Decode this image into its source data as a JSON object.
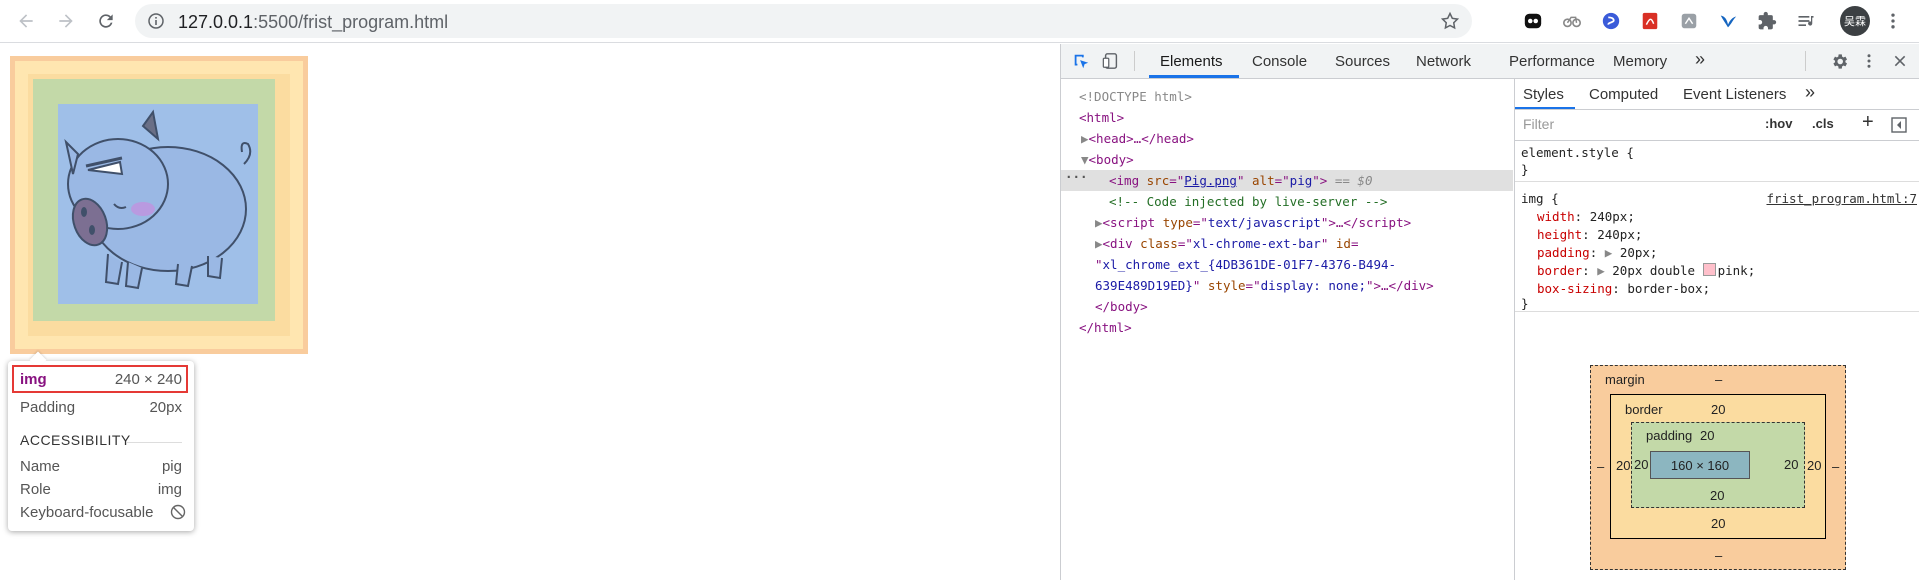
{
  "browser": {
    "url_host": "127.0.0.1",
    "url_rest": ":5500/frist_program.html",
    "avatar_text": "吴霖"
  },
  "tooltip": {
    "tag": "img",
    "size": "240 × 240",
    "padding_label": "Padding",
    "padding_value": "20px",
    "section": "ACCESSIBILITY",
    "name_label": "Name",
    "name_value": "pig",
    "role_label": "Role",
    "role_value": "img",
    "kbd_label": "Keyboard-focusable"
  },
  "devtools": {
    "tabs": [
      "Elements",
      "Console",
      "Sources",
      "Network",
      "Performance",
      "Memory"
    ],
    "more": "»"
  },
  "elements": {
    "doctype": "<!DOCTYPE html>",
    "html_open": "<html>",
    "head": "<head>…</head>",
    "body_open": "<body>",
    "img_src": "Pig.png",
    "img_alt": "pig",
    "img_suffix": " == $0",
    "comment": "<!-- Code injected by live-server -->",
    "script_type": "text/javascript",
    "div_class": "xl-chrome-ext-bar",
    "div_id": "xl_chrome_ext_{4DB361DE-01F7-4376-B494-",
    "div_id_cont": "639E489D19ED}",
    "div_style": "display: none;",
    "body_close": "</body>",
    "html_close": "</html>"
  },
  "styles": {
    "tabs": [
      "Styles",
      "Computed",
      "Event Listeners"
    ],
    "more": "»",
    "filter_placeholder": "Filter",
    "hov": ":hov",
    "cls": ".cls",
    "element_style": "element.style {",
    "close_brace": "}",
    "selector": "img {",
    "source": "frist_program.html:7",
    "props": [
      {
        "name": "width",
        "value": "240px;"
      },
      {
        "name": "height",
        "value": "240px;"
      },
      {
        "name": "padding",
        "value": "20px;"
      },
      {
        "name": "border",
        "value": "20px double"
      },
      {
        "name": "box-sizing",
        "value": "border-box;"
      }
    ],
    "border_color": "pink;"
  },
  "box_model": {
    "margin_label": "margin",
    "margin_top": "–",
    "margin_left": "–",
    "margin_right": "–",
    "margin_bottom": "–",
    "border_label": "border",
    "border_top": "20",
    "border_left": "20",
    "border_right": "20",
    "border_bottom": "20",
    "padding_label": "padding",
    "padding_top": "20",
    "padding_left": "20",
    "padding_right": "20",
    "padding_bottom": "20",
    "content": "160 × 160"
  }
}
